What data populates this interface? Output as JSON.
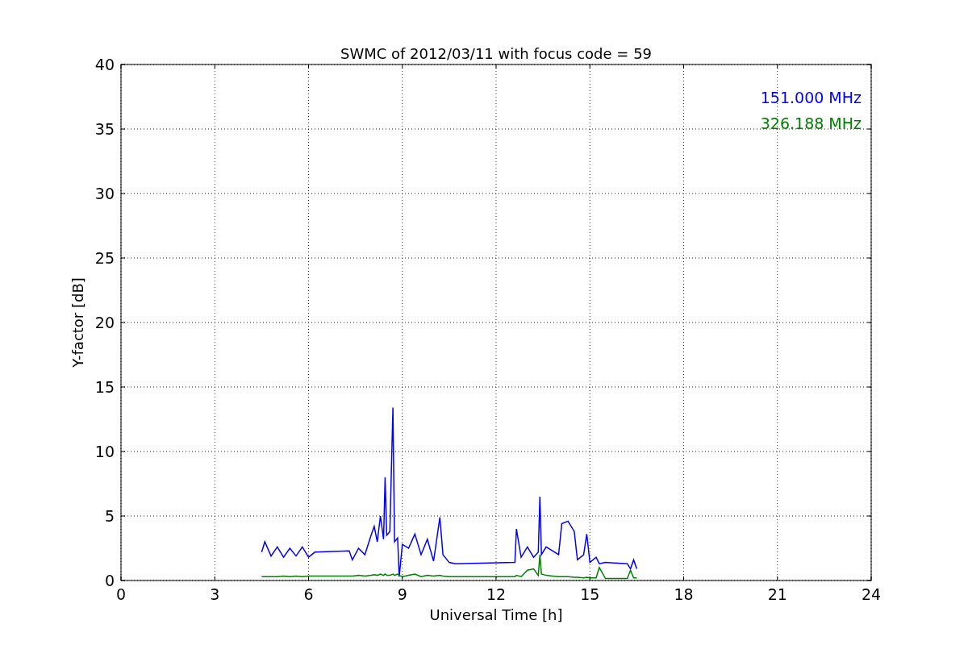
{
  "chart_data": {
    "type": "line",
    "title": "SWMC of 2012/03/11 with focus code = 59",
    "xlabel": "Universal Time [h]",
    "ylabel": "Y-factor [dB]",
    "x": [
      4.5,
      4.6,
      4.8,
      5.0,
      5.2,
      5.4,
      5.6,
      5.8,
      6.0,
      6.2,
      7.3,
      7.4,
      7.6,
      7.8,
      8.0,
      8.1,
      8.2,
      8.3,
      8.4,
      8.45,
      8.5,
      8.6,
      8.7,
      8.75,
      8.85,
      8.9,
      9.0,
      9.2,
      9.4,
      9.6,
      9.8,
      10.0,
      10.2,
      10.3,
      10.5,
      10.7,
      12.6,
      12.65,
      12.8,
      13.0,
      13.2,
      13.35,
      13.4,
      13.45,
      13.6,
      13.8,
      14.0,
      14.1,
      14.3,
      14.5,
      14.6,
      14.8,
      14.9,
      15.0,
      15.2,
      15.3,
      15.5,
      16.2,
      16.3,
      16.4,
      16.5
    ],
    "series": [
      {
        "name": "151.000 MHz",
        "color": "#0000ff",
        "values": [
          2.2,
          3.0,
          1.9,
          2.6,
          1.8,
          2.5,
          1.9,
          2.6,
          1.8,
          2.2,
          2.3,
          1.6,
          2.5,
          2.0,
          3.5,
          4.2,
          3.0,
          5.0,
          3.2,
          8.0,
          3.5,
          3.8,
          13.4,
          3.0,
          3.3,
          0.3,
          2.8,
          2.5,
          3.6,
          2.0,
          3.2,
          1.5,
          4.9,
          2.0,
          1.4,
          1.3,
          1.4,
          4.0,
          1.8,
          2.6,
          1.8,
          2.2,
          6.5,
          2.0,
          2.6,
          2.3,
          2.0,
          4.4,
          4.6,
          3.8,
          1.6,
          2.0,
          3.6,
          1.4,
          1.8,
          1.3,
          1.4,
          1.3,
          0.9,
          1.6,
          0.9
        ]
      },
      {
        "name": "326.188 MHz",
        "color": "#008000",
        "values": [
          0.3,
          0.3,
          0.3,
          0.3,
          0.35,
          0.3,
          0.35,
          0.3,
          0.35,
          0.35,
          0.35,
          0.35,
          0.4,
          0.35,
          0.4,
          0.45,
          0.4,
          0.5,
          0.4,
          0.5,
          0.4,
          0.4,
          0.5,
          0.4,
          0.5,
          0.4,
          0.3,
          0.4,
          0.5,
          0.3,
          0.4,
          0.35,
          0.4,
          0.35,
          0.3,
          0.3,
          0.3,
          0.4,
          0.3,
          0.8,
          0.9,
          0.4,
          2.0,
          0.5,
          0.4,
          0.35,
          0.3,
          0.3,
          0.3,
          0.25,
          0.25,
          0.2,
          0.25,
          0.2,
          0.2,
          1.0,
          0.15,
          0.15,
          0.8,
          0.2,
          0.2
        ]
      }
    ],
    "grid": true,
    "xlim": [
      0,
      24
    ],
    "ylim": [
      0,
      40
    ],
    "xticks": [
      0,
      3,
      6,
      9,
      12,
      15,
      18,
      21,
      24
    ],
    "yticks": [
      0,
      5,
      10,
      15,
      20,
      25,
      30,
      35,
      40
    ]
  }
}
